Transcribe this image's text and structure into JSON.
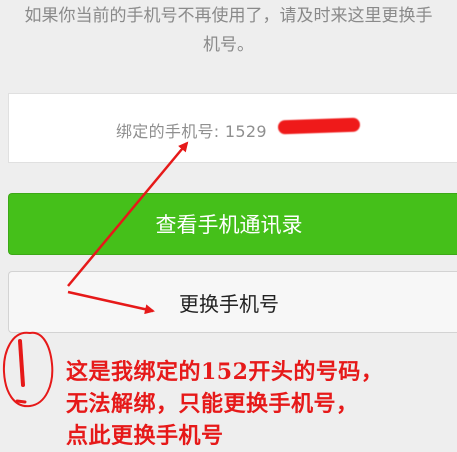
{
  "hint": {
    "line1": "如果你当前的手机号不再使用了，请及时来这里更换手",
    "line2": "机号。"
  },
  "bound_phone": {
    "text": "绑定的手机号: 1529"
  },
  "buttons": {
    "contacts": "查看手机通讯录",
    "change_number": "更换手机号"
  },
  "annotation": {
    "line1": "这是我绑定的152开头的号码，",
    "line2": "无法解绑，只能更换手机号，",
    "line3": "点此更换手机号"
  },
  "colors": {
    "primary_green": "#45c01a",
    "annotation_red": "#e61919"
  }
}
